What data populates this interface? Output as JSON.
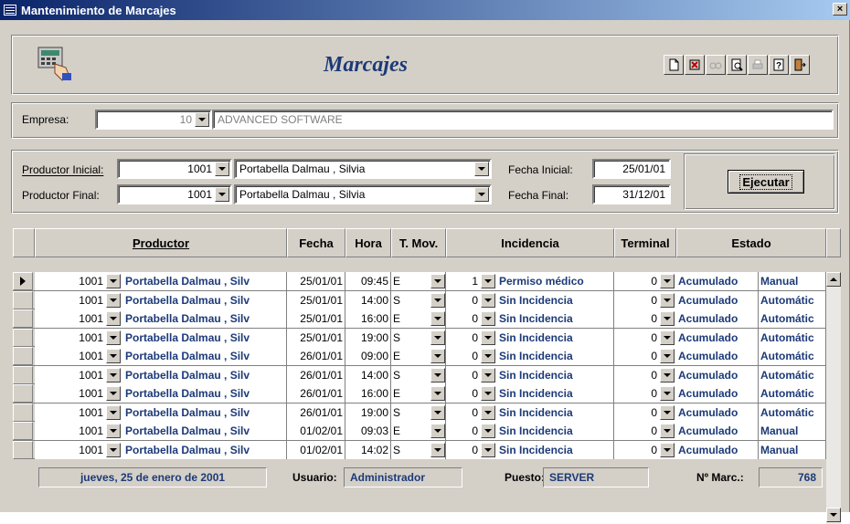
{
  "window": {
    "title": "Mantenimiento de Marcajes",
    "close_label": "×"
  },
  "header": {
    "title": "Marcajes",
    "tools": [
      {
        "icon": "new-record-icon",
        "glyph": "🗋"
      },
      {
        "icon": "delete-icon",
        "glyph": "✗"
      },
      {
        "icon": "find-icon",
        "glyph": "🔍"
      },
      {
        "icon": "print-preview-icon",
        "glyph": "🔎"
      },
      {
        "icon": "print-icon",
        "glyph": "⎙"
      },
      {
        "icon": "help-icon",
        "glyph": "?"
      },
      {
        "icon": "exit-icon",
        "glyph": "⇥"
      }
    ]
  },
  "empresa": {
    "label": "Empresa:",
    "code": "10",
    "name": "ADVANCED SOFTWARE"
  },
  "filters": {
    "prod_ini_label": "Productor Inicial:",
    "prod_ini_code": "1001",
    "prod_ini_name": "Portabella Dalmau , Silvia",
    "prod_fin_label": "Productor Final:",
    "prod_fin_code": "1001",
    "prod_fin_name": "Portabella Dalmau , Silvia",
    "fecha_ini_label": "Fecha Inicial:",
    "fecha_ini": "25/01/01",
    "fecha_fin_label": "Fecha Final:",
    "fecha_fin": "31/12/01",
    "execute_label": "Ejecutar"
  },
  "grid": {
    "headers": {
      "productor": "Productor",
      "fecha": "Fecha",
      "hora": "Hora",
      "tmov": "T. Mov.",
      "incidencia": "Incidencia",
      "terminal": "Terminal",
      "estado": "Estado"
    },
    "rows": [
      {
        "code": "1001",
        "name": "Portabella Dalmau , Silv",
        "fecha": "25/01/01",
        "hora": "09:45",
        "tmov": "E",
        "inc": "1",
        "inc_name": "Permiso médico",
        "term": "0",
        "estado": "Acumulado",
        "modo": "Manual"
      },
      {
        "code": "1001",
        "name": "Portabella Dalmau , Silv",
        "fecha": "25/01/01",
        "hora": "14:00",
        "tmov": "S",
        "inc": "0",
        "inc_name": "Sin Incidencia",
        "term": "0",
        "estado": "Acumulado",
        "modo": "Automátic"
      },
      {
        "code": "1001",
        "name": "Portabella Dalmau , Silv",
        "fecha": "25/01/01",
        "hora": "16:00",
        "tmov": "E",
        "inc": "0",
        "inc_name": "Sin Incidencia",
        "term": "0",
        "estado": "Acumulado",
        "modo": "Automátic"
      },
      {
        "code": "1001",
        "name": "Portabella Dalmau , Silv",
        "fecha": "25/01/01",
        "hora": "19:00",
        "tmov": "S",
        "inc": "0",
        "inc_name": "Sin Incidencia",
        "term": "0",
        "estado": "Acumulado",
        "modo": "Automátic"
      },
      {
        "code": "1001",
        "name": "Portabella Dalmau , Silv",
        "fecha": "26/01/01",
        "hora": "09:00",
        "tmov": "E",
        "inc": "0",
        "inc_name": "Sin Incidencia",
        "term": "0",
        "estado": "Acumulado",
        "modo": "Automátic"
      },
      {
        "code": "1001",
        "name": "Portabella Dalmau , Silv",
        "fecha": "26/01/01",
        "hora": "14:00",
        "tmov": "S",
        "inc": "0",
        "inc_name": "Sin Incidencia",
        "term": "0",
        "estado": "Acumulado",
        "modo": "Automátic"
      },
      {
        "code": "1001",
        "name": "Portabella Dalmau , Silv",
        "fecha": "26/01/01",
        "hora": "16:00",
        "tmov": "E",
        "inc": "0",
        "inc_name": "Sin Incidencia",
        "term": "0",
        "estado": "Acumulado",
        "modo": "Automátic"
      },
      {
        "code": "1001",
        "name": "Portabella Dalmau , Silv",
        "fecha": "26/01/01",
        "hora": "19:00",
        "tmov": "S",
        "inc": "0",
        "inc_name": "Sin Incidencia",
        "term": "0",
        "estado": "Acumulado",
        "modo": "Automátic"
      },
      {
        "code": "1001",
        "name": "Portabella Dalmau , Silv",
        "fecha": "01/02/01",
        "hora": "09:03",
        "tmov": "E",
        "inc": "0",
        "inc_name": "Sin Incidencia",
        "term": "0",
        "estado": "Acumulado",
        "modo": "Manual"
      },
      {
        "code": "1001",
        "name": "Portabella Dalmau , Silv",
        "fecha": "01/02/01",
        "hora": "14:02",
        "tmov": "S",
        "inc": "0",
        "inc_name": "Sin Incidencia",
        "term": "0",
        "estado": "Acumulado",
        "modo": "Manual"
      }
    ]
  },
  "statusbar": {
    "date": "jueves, 25 de enero de 2001",
    "user_label": "Usuario:",
    "user": "Administrador",
    "puesto_label": "Puesto:",
    "puesto": "SERVER",
    "count_label": "Nº Marc.:",
    "count": "768"
  },
  "colors": {
    "accent": "#1c3a78",
    "face": "#d4d0c8",
    "title_start": "#0a246a"
  }
}
